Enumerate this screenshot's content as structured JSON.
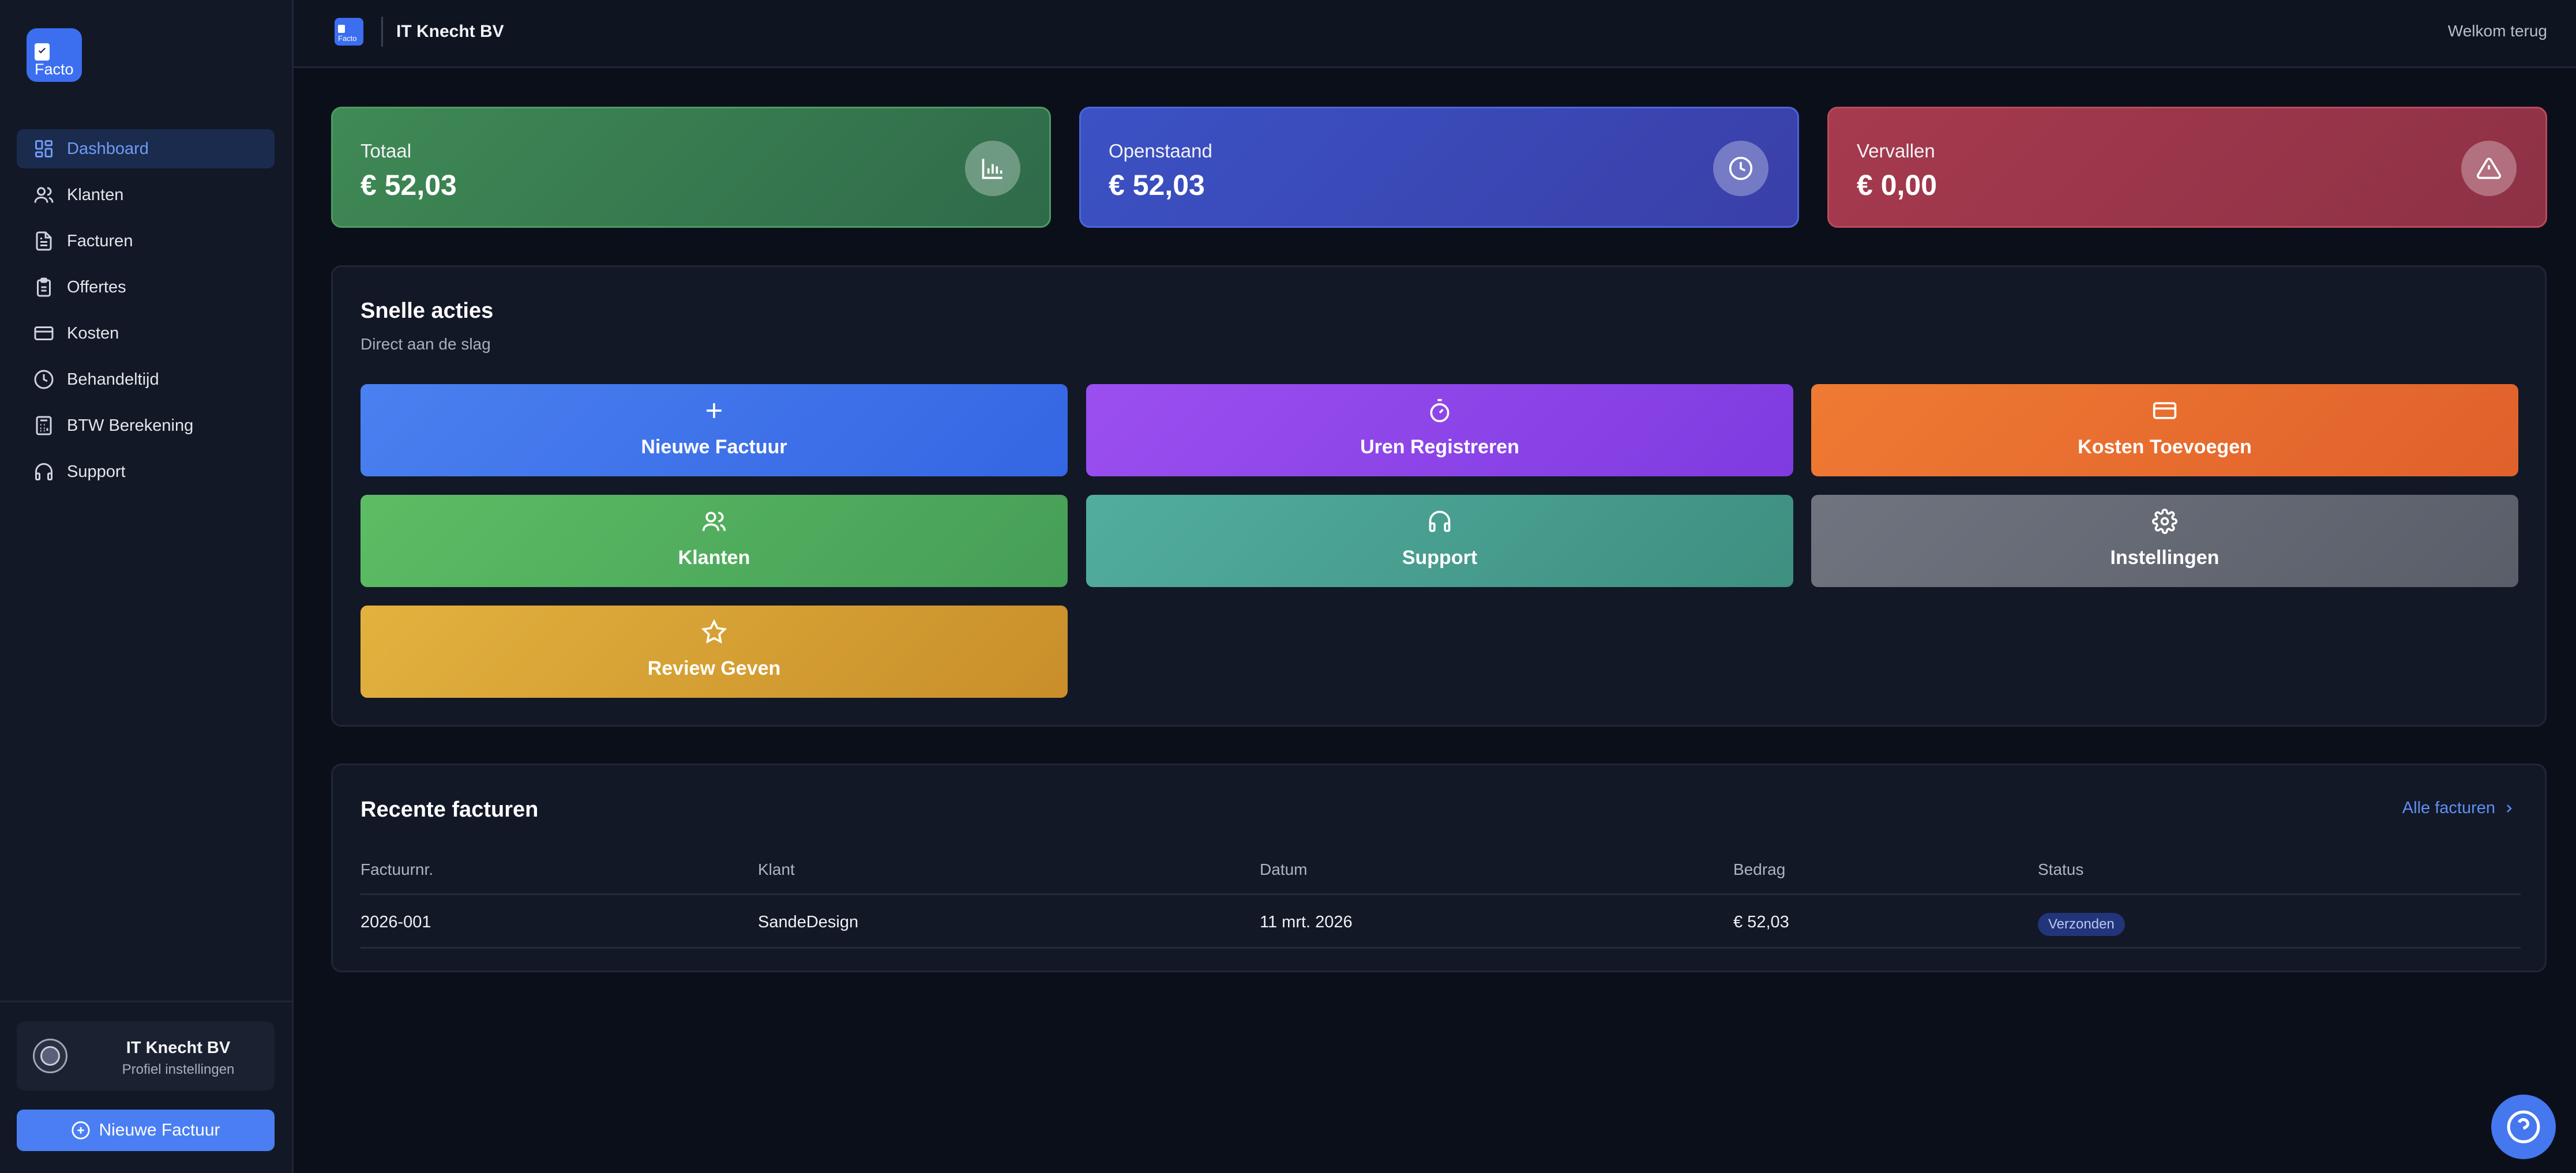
{
  "app": {
    "logo_text": "Facto"
  },
  "sidebar": {
    "items": [
      {
        "label": "Dashboard",
        "icon": "dashboard-icon",
        "active": true
      },
      {
        "label": "Klanten",
        "icon": "users-icon"
      },
      {
        "label": "Facturen",
        "icon": "file-icon"
      },
      {
        "label": "Offertes",
        "icon": "clipboard-icon"
      },
      {
        "label": "Kosten",
        "icon": "credit-card-icon"
      },
      {
        "label": "Behandeltijd",
        "icon": "clock-icon"
      },
      {
        "label": "BTW Berekening",
        "icon": "calculator-icon"
      },
      {
        "label": "Support",
        "icon": "headphones-icon"
      }
    ],
    "profile": {
      "name": "IT Knecht BV",
      "subtitle": "Profiel instellingen"
    },
    "new_invoice_label": "Nieuwe Factuur"
  },
  "topbar": {
    "logo_text": "Facto",
    "company": "IT Knecht BV",
    "welcome": "Welkom terug"
  },
  "stats": [
    {
      "label": "Totaal",
      "value": "€ 52,03",
      "icon": "bar-chart-icon",
      "color": "#3f8a55"
    },
    {
      "label": "Openstaand",
      "value": "€ 52,03",
      "icon": "clock-icon",
      "color": "#3b52c4"
    },
    {
      "label": "Vervallen",
      "value": "€ 0,00",
      "icon": "alert-triangle-icon",
      "color": "#a63a4e"
    }
  ],
  "quick_actions": {
    "title": "Snelle acties",
    "subtitle": "Direct aan de slag",
    "items": [
      {
        "label": "Nieuwe Factuur",
        "icon": "plus-icon",
        "color": "#3f74ee"
      },
      {
        "label": "Uren Registreren",
        "icon": "timer-icon",
        "color": "#8f47ee"
      },
      {
        "label": "Kosten Toevoegen",
        "icon": "credit-card-icon",
        "color": "#ea7230"
      },
      {
        "label": "Klanten",
        "icon": "users-icon",
        "color": "#54b160"
      },
      {
        "label": "Support",
        "icon": "headphones-icon",
        "color": "#4aa396"
      },
      {
        "label": "Instellingen",
        "icon": "gear-icon",
        "color": "#676c78"
      },
      {
        "label": "Review Geven",
        "icon": "star-icon",
        "color": "#d9a83a"
      }
    ]
  },
  "recent_invoices": {
    "title": "Recente facturen",
    "all_link": "Alle facturen",
    "columns": [
      "Factuurnr.",
      "Klant",
      "Datum",
      "Bedrag",
      "Status"
    ],
    "rows": [
      {
        "number": "2026-001",
        "client": "SandeDesign",
        "date": "11 mrt. 2026",
        "amount": "€ 52,03",
        "status": "Verzonden"
      }
    ]
  }
}
